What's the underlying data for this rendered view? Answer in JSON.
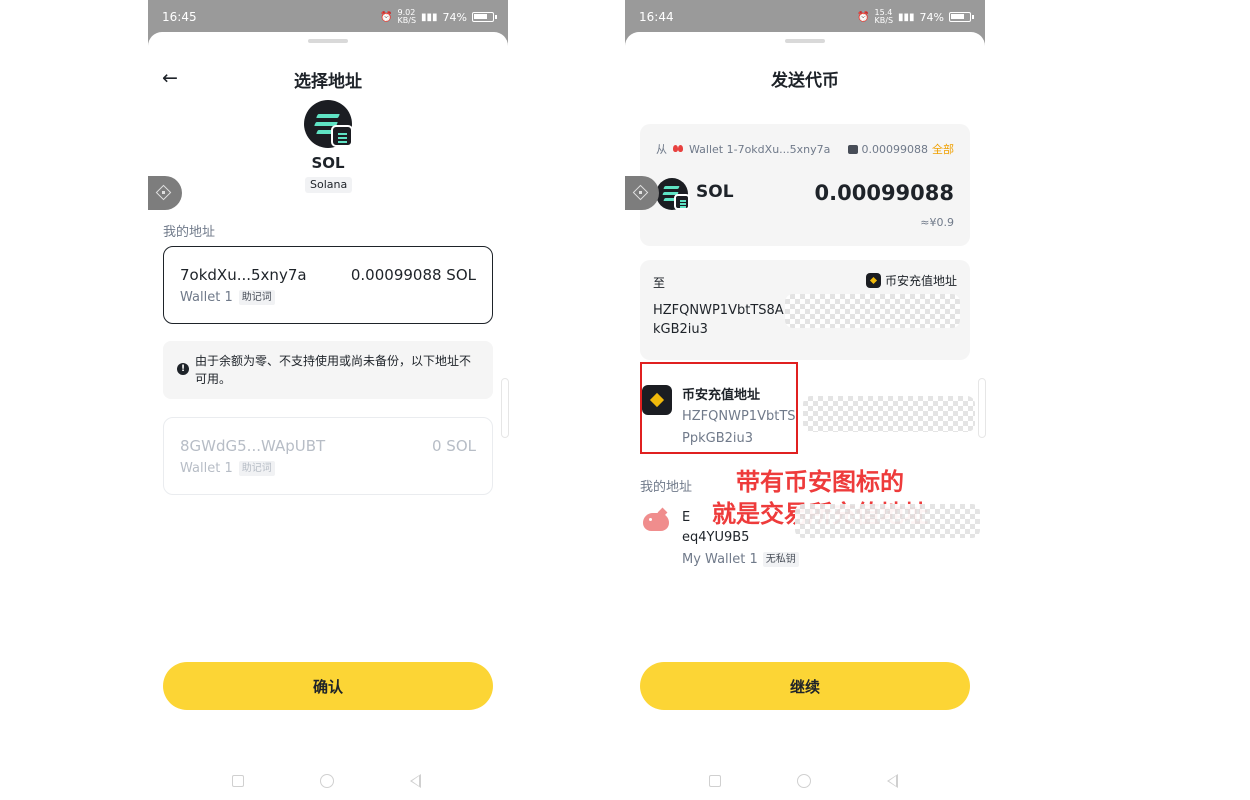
{
  "left": {
    "status": {
      "time": "16:45",
      "speed_top": "9.02",
      "speed_bottom": "KB/S",
      "battery": "74%"
    },
    "title": "选择地址",
    "token": {
      "symbol": "SOL",
      "chain": "Solana"
    },
    "section_label": "我的地址",
    "selected_address": {
      "address": "7okdXu...5xny7a",
      "balance": "0.00099088 SOL",
      "wallet": "Wallet 1",
      "tag": "助记词"
    },
    "notice": "由于余额为零、不支持使用或尚未备份，以下地址不可用。",
    "disabled_address": {
      "address": "8GWdG5...WApUBT",
      "balance": "0 SOL",
      "wallet": "Wallet 1",
      "tag": "助记词"
    },
    "confirm_label": "确认"
  },
  "right": {
    "status": {
      "time": "16:44",
      "speed_top": "15.4",
      "speed_bottom": "KB/S",
      "battery": "74%"
    },
    "title": "发送代币",
    "from": {
      "label": "从",
      "wallet": "Wallet 1-7okdXu...5xny7a",
      "balance": "0.00099088",
      "all_label": "全部",
      "symbol": "SOL",
      "amount": "0.00099088",
      "fiat": "≈¥0.9"
    },
    "to": {
      "label": "至",
      "tag": "币安充值地址",
      "address_line1": "HZFQNWP1VbtTS8A",
      "address_line2": "kGB2iu3"
    },
    "binance_entry": {
      "name": "币安充值地址",
      "address_line1": "HZFQNWP1VbtTS",
      "address_line2": "PpkGB2iu3"
    },
    "annotation": {
      "line1": "带有币安图标的",
      "line2": "就是交易所充值地址"
    },
    "my_section_label": "我的地址",
    "my_address": {
      "line1": "E",
      "line2": "eq4YU9B5",
      "wallet": "My Wallet 1",
      "tag": "无私钥"
    },
    "continue_label": "继续"
  },
  "colors": {
    "accent_yellow": "#fcd535",
    "annotation_red": "#ee3b3b",
    "binance_gold": "#f0b90b"
  }
}
